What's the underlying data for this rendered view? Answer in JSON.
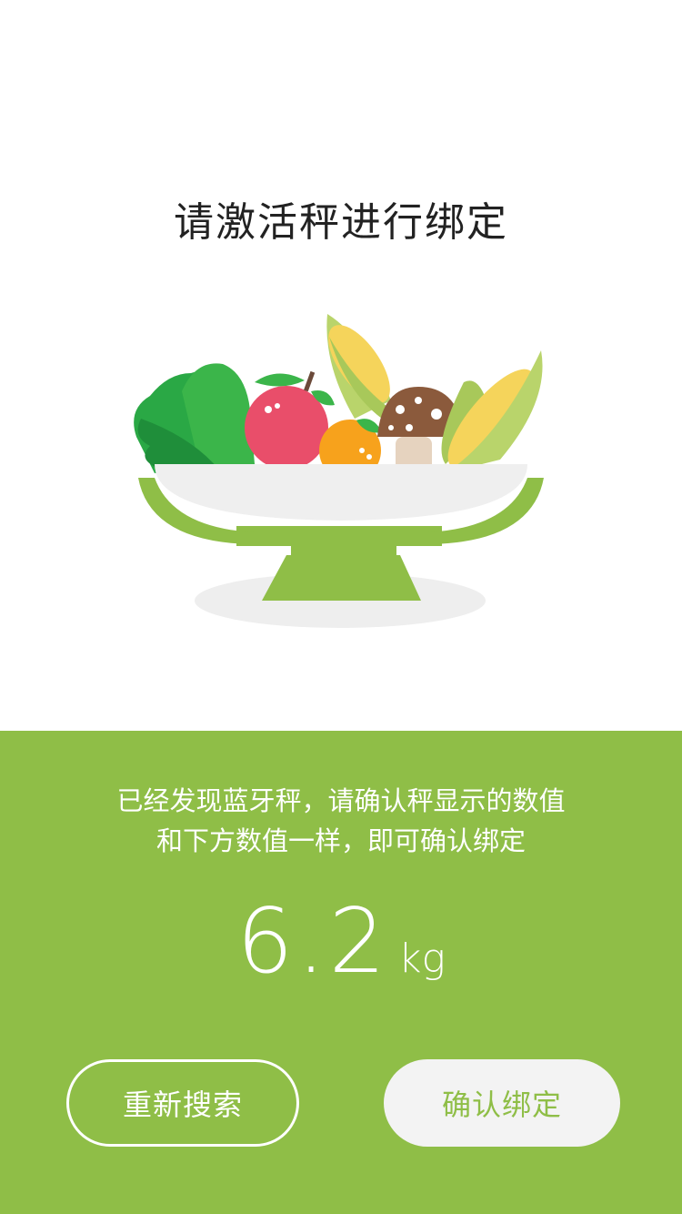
{
  "page": {
    "title": "请激活秤进行绑定"
  },
  "illustration": {
    "icon": "scale-with-vegetables-icon",
    "colors": {
      "scale_green": "#8fbe47",
      "bowl": "#efefef",
      "apple": "#e94e6a",
      "orange": "#f7a21c",
      "leaf": "#2aa845",
      "corn": "#f5d45b",
      "mushroom": "#8b5a3c"
    }
  },
  "status": {
    "line1": "已经发现蓝牙秤，请确认秤显示的数值",
    "line2": "和下方数值一样，即可确认绑定"
  },
  "reading": {
    "value": "6.2",
    "unit": "kg"
  },
  "actions": {
    "rescan_label": "重新搜索",
    "confirm_label": "确认绑定"
  },
  "theme": {
    "accent": "#8fbe47",
    "background": "#ffffff",
    "button_light": "#f3f3f3"
  }
}
